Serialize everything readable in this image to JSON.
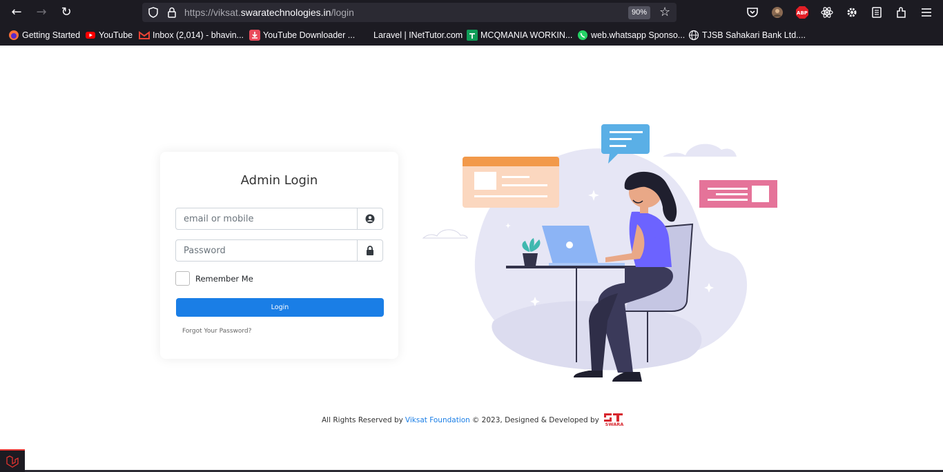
{
  "browser": {
    "url_prefix": "https://viksat.",
    "url_host": "swaratechnologies.in",
    "url_path": "/login",
    "zoom": "90%"
  },
  "bookmarks": [
    {
      "label": "Getting Started",
      "icon": "firefox-icon"
    },
    {
      "label": "YouTube",
      "icon": "youtube-icon"
    },
    {
      "label": "Inbox (2,014) - bhavin...",
      "icon": "gmail-icon"
    },
    {
      "label": "YouTube Downloader ...",
      "icon": "download-icon"
    },
    {
      "label": "Laravel | INetTutor.com",
      "icon": "blank-icon"
    },
    {
      "label": "MCQMANIA WORKIN...",
      "icon": "sheets-icon"
    },
    {
      "label": "web.whatsapp Sponso...",
      "icon": "whatsapp-icon"
    },
    {
      "label": "TJSB Sahakari Bank Ltd....",
      "icon": "globe-icon"
    }
  ],
  "login": {
    "title": "Admin Login",
    "email_placeholder": "email or mobile",
    "password_placeholder": "Password",
    "remember_label": "Remember Me",
    "login_button": "Login",
    "forgot_link": "Forgot Your Password?"
  },
  "footer": {
    "prefix": "All Rights Reserved by",
    "foundation": "Viksat Foundation",
    "suffix": "© 2023, Designed & Developed by",
    "logo_text": "SWARA"
  },
  "colors": {
    "primary": "#1a7ee6",
    "illustration_purple": "#6c63ff",
    "blob": "#e6e6f5"
  }
}
